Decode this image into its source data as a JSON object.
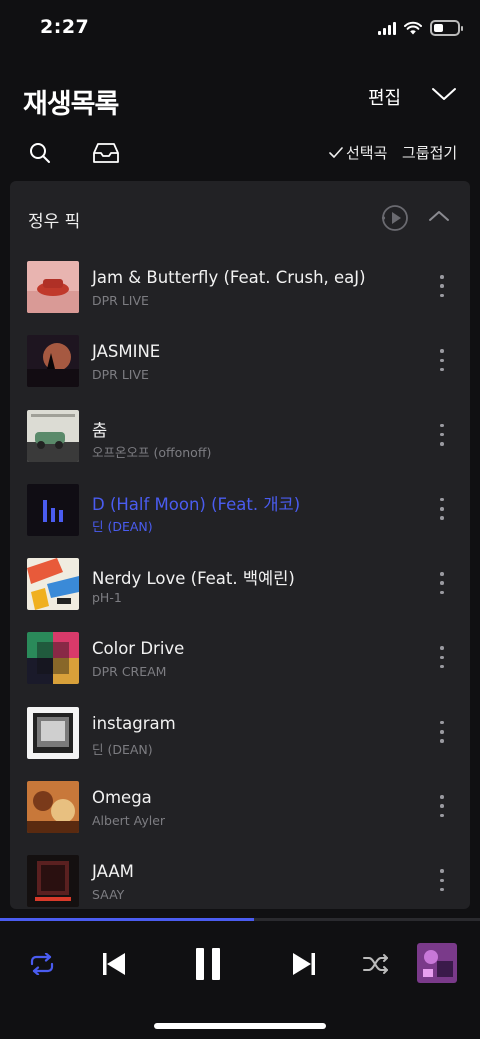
{
  "status_bar": {
    "time": "2:27",
    "icons": [
      "signal-icon",
      "wifi-icon",
      "battery-icon"
    ]
  },
  "header": {
    "title": "재생목록",
    "edit_label": "편집",
    "collapse_icon": "chevron-down-icon"
  },
  "toolbar": {
    "search_icon": "search-icon",
    "inbox_icon": "inbox-icon",
    "select_label": "선택곡",
    "group_label": "그룹접기"
  },
  "group": {
    "title": "정우 픽",
    "tracks": [
      {
        "title": "Jam & Butterfly (Feat. Crush, eaJ)",
        "artist": "DPR LIVE",
        "active": false
      },
      {
        "title": "JASMINE",
        "artist": "DPR LIVE",
        "active": false
      },
      {
        "title": "춤",
        "artist": "오프온오프 (offonoff)",
        "active": false
      },
      {
        "title": "D (Half Moon) (Feat. 개코)",
        "artist": "딘 (DEAN)",
        "active": true
      },
      {
        "title": "Nerdy Love (Feat. 백예린)",
        "artist": "pH-1",
        "active": false
      },
      {
        "title": "Color Drive",
        "artist": "DPR CREAM",
        "active": false
      },
      {
        "title": "instagram",
        "artist": "딘 (DEAN)",
        "active": false
      },
      {
        "title": "Omega",
        "artist": "Albert Ayler",
        "active": false
      },
      {
        "title": "JAAM",
        "artist": "SAAY",
        "active": false
      }
    ]
  },
  "player": {
    "progress": 0.53,
    "controls": [
      "repeat-icon",
      "previous-icon",
      "pause-icon",
      "next-icon",
      "shuffle-icon"
    ]
  },
  "colors": {
    "accent": "#4a5cf0",
    "background": "#101012",
    "card": "#222225"
  }
}
